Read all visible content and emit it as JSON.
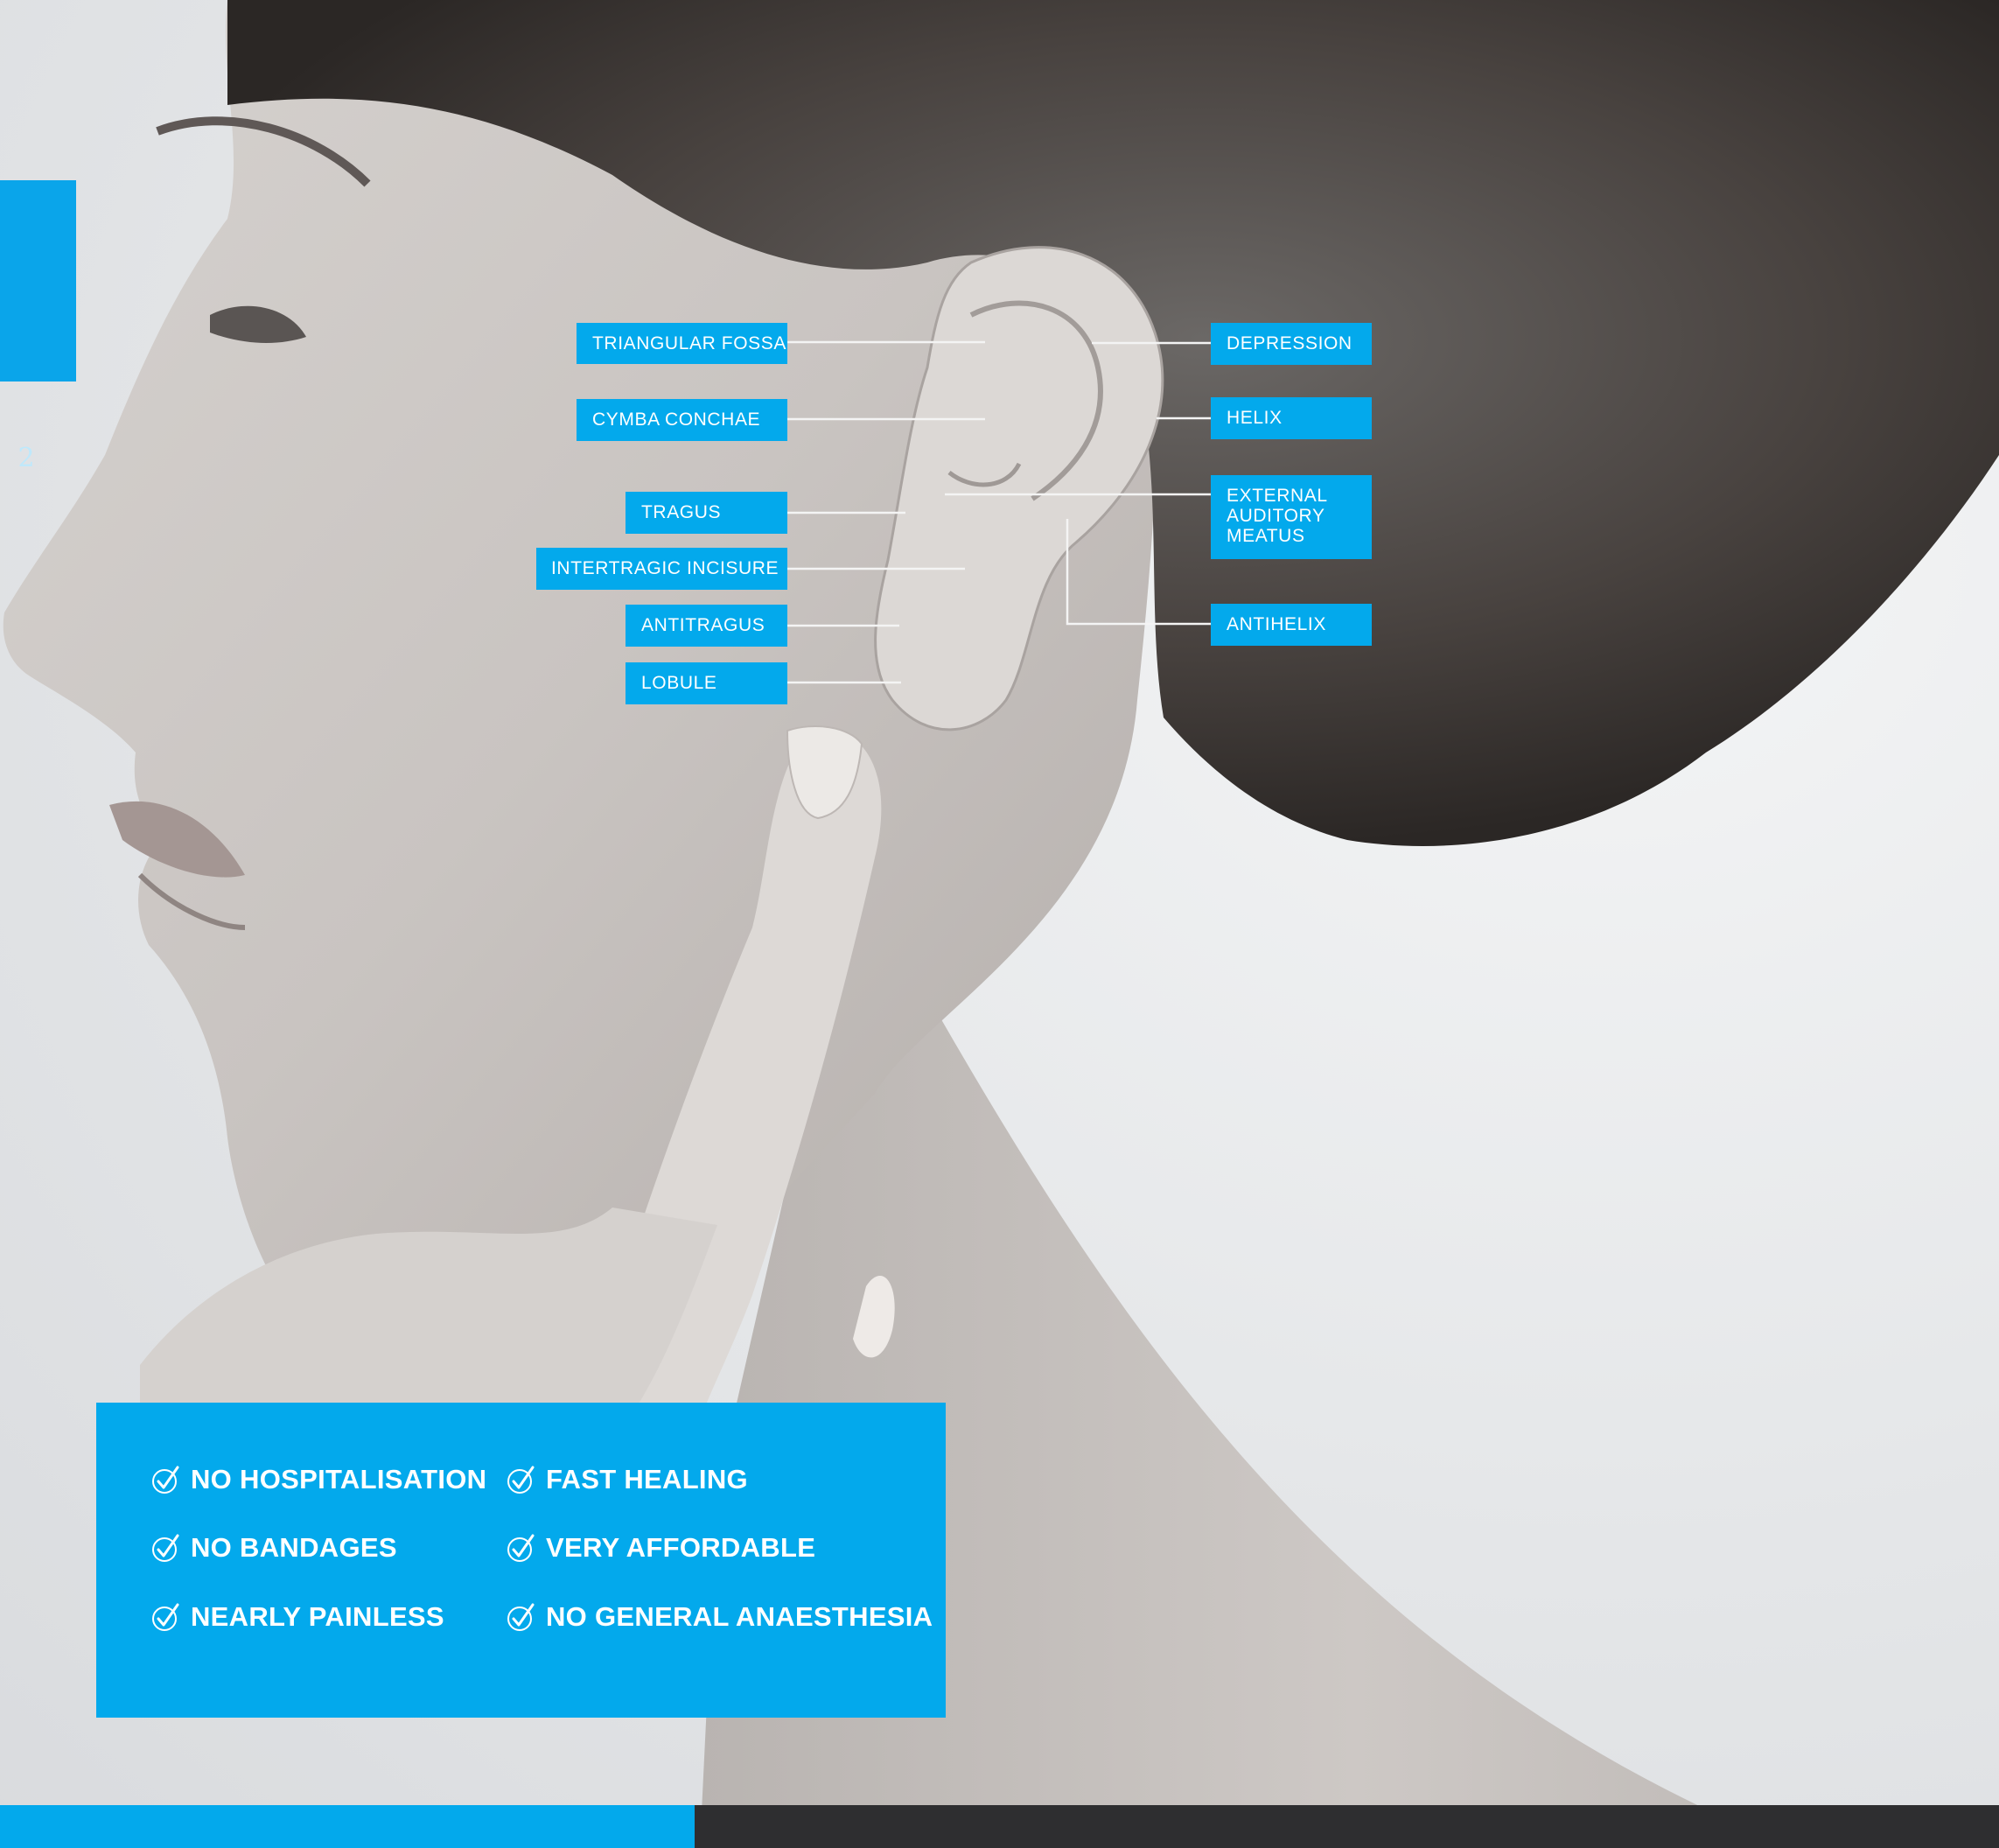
{
  "page": {
    "number": "2",
    "accent_color": "#03a9ec",
    "footer_dark_color": "#2e2e30"
  },
  "photo": {
    "icon": "woman-profile-touching-ear-photo"
  },
  "labels": {
    "triangular_fossa": "TRIANGULAR FOSSA",
    "cymba_conchae": "CYMBA CONCHAE",
    "tragus": "TRAGUS",
    "intertragic_incisure": "INTERTRAGIC INCISURE",
    "antitragus": "ANTITRAGUS",
    "lobule": "LOBULE",
    "depression": "DEPRESSION",
    "helix": "HELIX",
    "external_auditory_meatus": "EXTERNAL\nAUDITORY\nMEATUS",
    "antihelix": "ANTIHELIX"
  },
  "benefits": {
    "icon": "checkmark-circle-icon",
    "items": [
      "NO HOSPITALISATION",
      "FAST HEALING",
      "NO BANDAGES",
      "VERY AFFORDABLE",
      "NEARLY PAINLESS",
      "NO GENERAL ANAESTHESIA"
    ]
  }
}
